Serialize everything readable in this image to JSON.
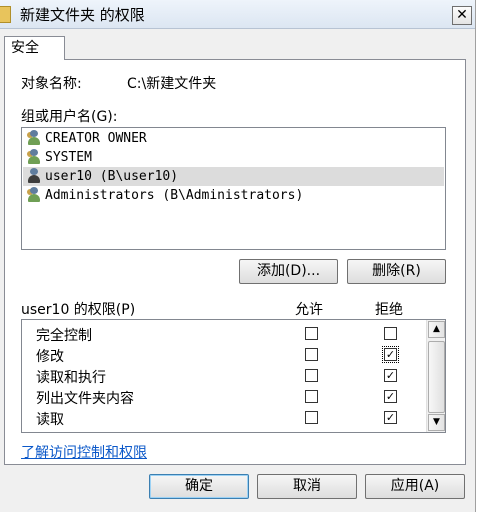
{
  "window": {
    "title": "新建文件夹 的权限",
    "close_glyph": "✕"
  },
  "tabs": [
    {
      "label": "安全"
    }
  ],
  "object": {
    "label": "对象名称:",
    "value": "C:\\新建文件夹"
  },
  "groups": {
    "label": "组或用户名(G):",
    "items": [
      {
        "text": "CREATOR OWNER",
        "icon": "group-icon"
      },
      {
        "text": "SYSTEM",
        "icon": "group-icon"
      },
      {
        "text": "user10 (B\\user10)",
        "icon": "user-icon",
        "selected": true
      },
      {
        "text": "Administrators (B\\Administrators)",
        "icon": "group-icon"
      }
    ]
  },
  "buttons": {
    "add": "添加(D)...",
    "remove": "删除(R)"
  },
  "permissions": {
    "label": "user10 的权限(P)",
    "allow_header": "允许",
    "deny_header": "拒绝",
    "rows": [
      {
        "name": "完全控制",
        "allow": false,
        "deny": false
      },
      {
        "name": "修改",
        "allow": false,
        "deny": true
      },
      {
        "name": "读取和执行",
        "allow": false,
        "deny": true
      },
      {
        "name": "列出文件夹内容",
        "allow": false,
        "deny": true
      },
      {
        "name": "读取",
        "allow": false,
        "deny": true
      }
    ]
  },
  "link": {
    "text": "了解访问控制和权限"
  },
  "footer": {
    "ok": "确定",
    "cancel": "取消",
    "apply": "应用(A)"
  },
  "colors": {
    "link": "#0b58c9",
    "selection": "#dcdcdc"
  }
}
